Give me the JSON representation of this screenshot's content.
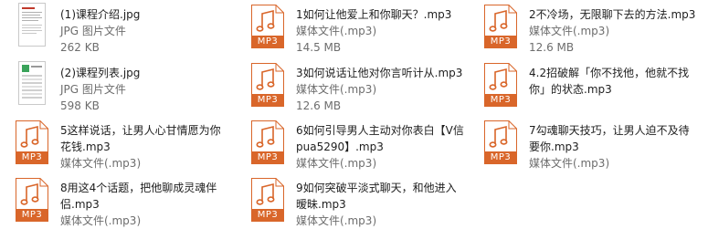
{
  "files": [
    {
      "name": "(1)课程介绍.jpg",
      "type": "JPG 图片文件",
      "size": "262 KB",
      "icon": "jpg-thumbnail-icon"
    },
    {
      "name": "1如何让他爱上和你聊天？.mp3",
      "type": "媒体文件(.mp3)",
      "size": "14.5 MB",
      "icon": "mp3-file-icon"
    },
    {
      "name": "2不冷场，无限聊下去的方法.mp3",
      "type": "媒体文件(.mp3)",
      "size": "12.6 MB",
      "icon": "mp3-file-icon"
    },
    {
      "name": "(2)课程列表.jpg",
      "type": "JPG 图片文件",
      "size": "598 KB",
      "icon": "jpg-thumbnail-icon"
    },
    {
      "name": "3如何说话让他对你言听计从.mp3",
      "type": "媒体文件(.mp3)",
      "size": "12.6 MB",
      "icon": "mp3-file-icon"
    },
    {
      "name": "4.2招破解「你不找他，他就不找你」的状态.mp3",
      "type": "",
      "size": "",
      "icon": "mp3-file-icon"
    },
    {
      "name": "5这样说话，让男人心甘情愿为你花钱.mp3",
      "type": "媒体文件(.mp3)",
      "size": "",
      "icon": "mp3-file-icon"
    },
    {
      "name": "6如何引导男人主动对你表白【V信pua5290】.mp3",
      "type": "媒体文件(.mp3)",
      "size": "",
      "icon": "mp3-file-icon"
    },
    {
      "name": "7勾魂聊天技巧，让男人迫不及待要你.mp3",
      "type": "媒体文件(.mp3)",
      "size": "",
      "icon": "mp3-file-icon"
    },
    {
      "name": "8用这4个话题，把他聊成灵魂伴侣.mp3",
      "type": "媒体文件(.mp3)",
      "size": "",
      "icon": "mp3-file-icon"
    },
    {
      "name": "9如何突破平淡式聊天，和他进入暧昧.mp3",
      "type": "媒体文件(.mp3)",
      "size": "",
      "icon": "mp3-file-icon"
    }
  ],
  "mp3_badge": "MP3",
  "colors": {
    "accent": "#d9662a",
    "meta_text": "#6d6d6d"
  }
}
